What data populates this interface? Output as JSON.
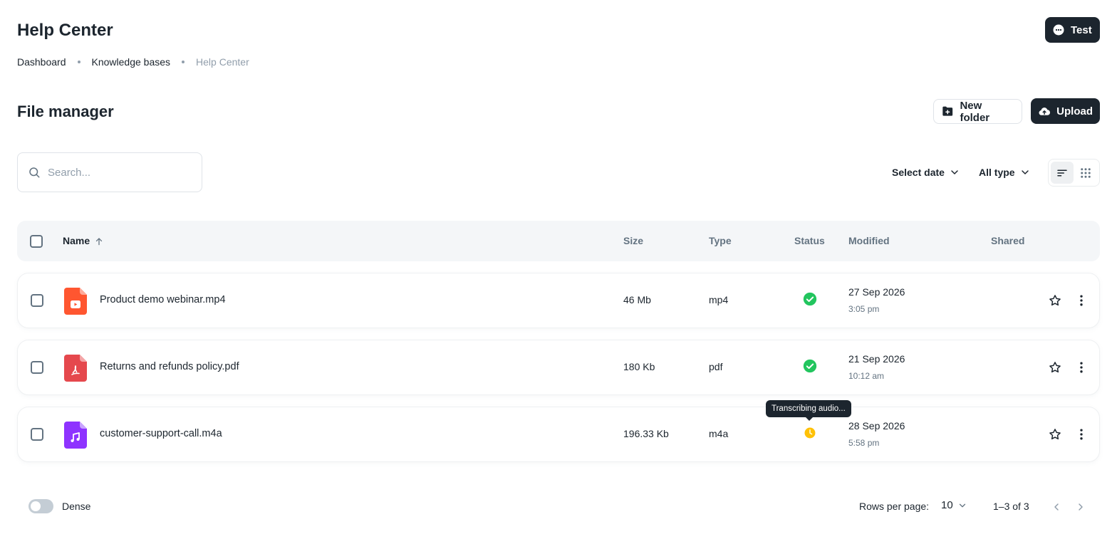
{
  "header": {
    "title": "Help Center",
    "test_button_label": "Test"
  },
  "breadcrumb": [
    "Dashboard",
    "Knowledge bases",
    "Help Center"
  ],
  "section": {
    "title": "File manager",
    "new_folder_label": "New folder",
    "upload_label": "Upload"
  },
  "toolbar": {
    "search_placeholder": "Search...",
    "date_filter_label": "Select date",
    "type_filter_label": "All type",
    "view_mode": "list"
  },
  "table": {
    "columns": [
      "Name",
      "Size",
      "Type",
      "Status",
      "Modified",
      "Shared"
    ],
    "sort": {
      "column": "Name",
      "direction": "asc"
    },
    "rows": [
      {
        "name": "Product demo webinar.mp4",
        "size": "46 Mb",
        "type": "mp4",
        "icon": "video-file-icon",
        "icon_color": "#ff5630",
        "status": "done",
        "date": "27 Sep 2026",
        "time": "3:05 pm"
      },
      {
        "name": "Returns and refunds policy.pdf",
        "size": "180 Kb",
        "type": "pdf",
        "icon": "pdf-file-icon",
        "icon_color": "#e5484d",
        "status": "done",
        "date": "21 Sep 2026",
        "time": "10:12 am"
      },
      {
        "name": "customer-support-call.m4a",
        "size": "196.33 Kb",
        "type": "m4a",
        "icon": "audio-file-icon",
        "icon_color": "#8e33ff",
        "status": "processing",
        "status_tooltip": "Transcribing audio...",
        "date": "28 Sep 2026",
        "time": "5:58 pm"
      }
    ]
  },
  "footer": {
    "dense_label": "Dense",
    "rows_per_page_label": "Rows per page:",
    "rows_per_page_value": "10",
    "page_range": "1–3 of 3"
  },
  "colors": {
    "primary_dark": "#1c252e",
    "success": "#22c55e",
    "warning": "#ffc107",
    "muted": "#919eab"
  }
}
